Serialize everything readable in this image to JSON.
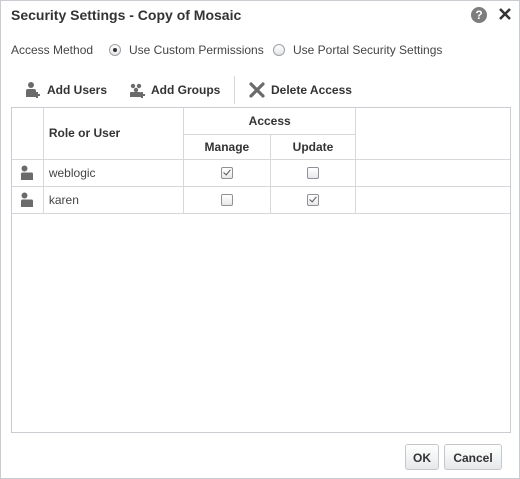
{
  "dialog": {
    "title": "Security Settings - Copy of Mosaic",
    "help_label": "?",
    "close_label": "✕"
  },
  "access_method": {
    "label": "Access Method",
    "options": [
      {
        "label": "Use Custom Permissions",
        "selected": true
      },
      {
        "label": "Use Portal Security Settings",
        "selected": false
      }
    ]
  },
  "toolbar": {
    "add_users": "Add Users",
    "add_groups": "Add Groups",
    "delete_access": "Delete Access"
  },
  "table": {
    "col_role": "Role or User",
    "col_access": "Access",
    "col_manage": "Manage",
    "col_update": "Update",
    "rows": [
      {
        "name": "weblogic",
        "manage": true,
        "update": false
      },
      {
        "name": "karen",
        "manage": false,
        "update": true
      }
    ]
  },
  "footer": {
    "ok": "OK",
    "cancel": "Cancel"
  },
  "icons": {
    "help": "help-icon",
    "close": "close-icon",
    "add_users": "add-user-icon",
    "add_groups": "add-group-icon",
    "delete": "delete-x-icon",
    "row_user": "user-icon"
  }
}
